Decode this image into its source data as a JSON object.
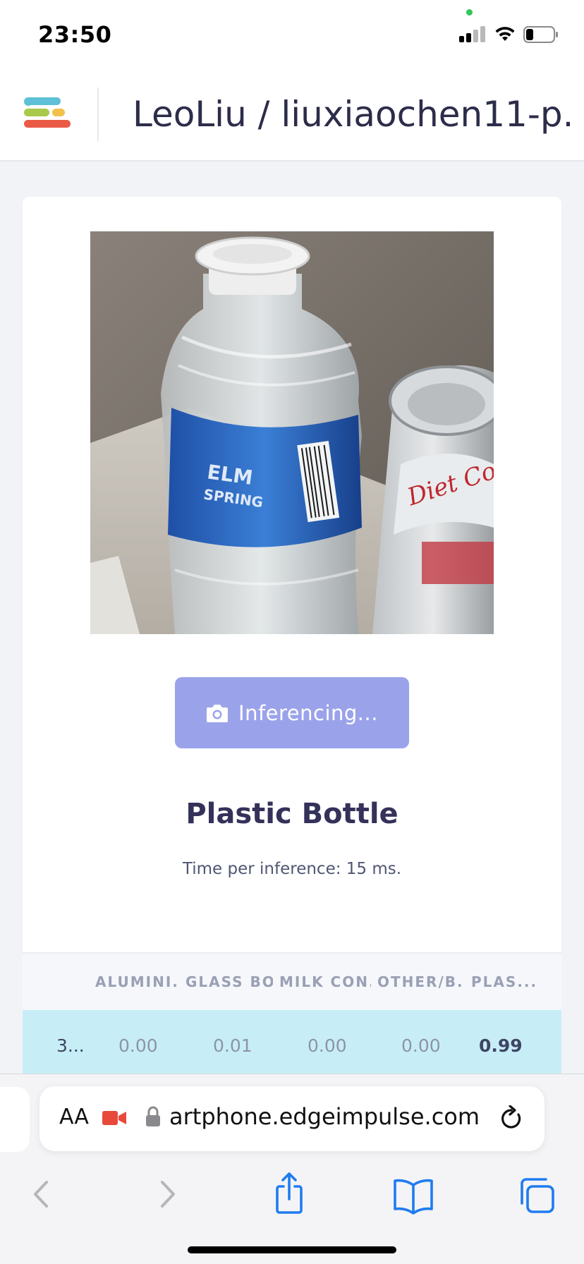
{
  "status_bar": {
    "time": "23:50",
    "icons": [
      "camera-in-use-dot",
      "cellular-signal-icon",
      "wifi-icon",
      "battery-icon"
    ]
  },
  "header": {
    "menu_icon": "edge-impulse-menu-icon",
    "project_title": "LeoLiu / liuxiaochen11-p..."
  },
  "card": {
    "camera_preview": "camera-preview-image",
    "capture_button": {
      "icon": "camera-icon",
      "label": "Inferencing..."
    },
    "result_label": "Plastic Bottle",
    "inference_time": "Time per inference: 15 ms.",
    "results_table": {
      "columns": [
        "",
        "ALUMINI...",
        "GLASS BO...",
        "MILK CON...",
        "OTHER/B...",
        "PLAS..."
      ],
      "rows": [
        {
          "cells": [
            "3...",
            "0.00",
            "0.01",
            "0.00",
            "0.00",
            "0.99"
          ]
        }
      ]
    }
  },
  "browser": {
    "text_size_label": "AA",
    "url": "artphone.edgeimpulse.com",
    "icons": [
      "camera-recording-icon",
      "lock-icon",
      "reload-icon"
    ],
    "toolbar": [
      "back-icon",
      "forward-icon",
      "share-icon",
      "bookmarks-icon",
      "tabs-icon"
    ]
  },
  "colors": {
    "button_bg": "#9aa3ea",
    "highlight_row": "#c7eef7",
    "title_text": "#34325a"
  }
}
